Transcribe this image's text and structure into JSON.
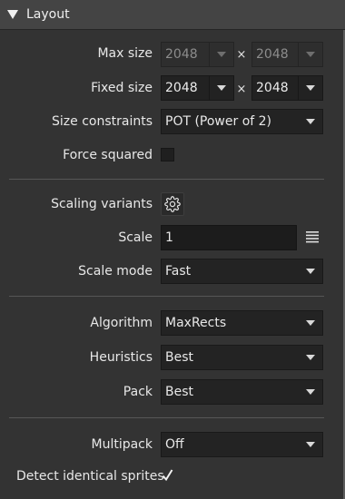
{
  "section": {
    "title": "Layout"
  },
  "max_size": {
    "label": "Max size",
    "width": "2048",
    "separator": "×",
    "height": "2048"
  },
  "fixed_size": {
    "label": "Fixed size",
    "width": "2048",
    "separator": "×",
    "height": "2048"
  },
  "size_constraints": {
    "label": "Size constraints",
    "value": "POT (Power of 2)"
  },
  "force_squared": {
    "label": "Force squared",
    "checked": false
  },
  "scaling_variants": {
    "label": "Scaling variants",
    "icon": "gear-icon"
  },
  "scale": {
    "label": "Scale",
    "value": "1",
    "icon": "list-icon"
  },
  "scale_mode": {
    "label": "Scale mode",
    "value": "Fast"
  },
  "algorithm": {
    "label": "Algorithm",
    "value": "MaxRects"
  },
  "heuristics": {
    "label": "Heuristics",
    "value": "Best"
  },
  "pack": {
    "label": "Pack",
    "value": "Best"
  },
  "multipack": {
    "label": "Multipack",
    "value": "Off"
  },
  "detect_identical": {
    "label": "Detect identical sprites",
    "checked": true
  },
  "colors": {
    "background": "#333333",
    "header": "#444444",
    "field": "#232323",
    "text": "#e8e8e8"
  }
}
